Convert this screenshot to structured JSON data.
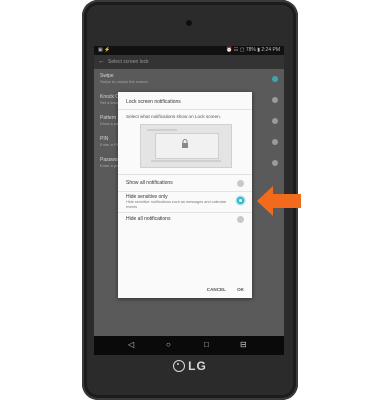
{
  "device": {
    "brand": "LG"
  },
  "status_bar": {
    "left_icons": "▣ ⚡",
    "right_text": "⏰ ☷ ▢ 78% ▮ 2:24 PM"
  },
  "title_bar": {
    "back_glyph": "←",
    "title": "Select screen lock"
  },
  "background_list": [
    {
      "label": "Swipe",
      "sub": "Swipe to unlock the screen",
      "selected": true
    },
    {
      "label": "Knock Code",
      "sub": "Set a knock code",
      "selected": false
    },
    {
      "label": "Pattern",
      "sub": "Draw a pattern",
      "selected": false
    },
    {
      "label": "PIN",
      "sub": "Enter a PIN",
      "selected": false
    },
    {
      "label": "Password",
      "sub": "Enter a password",
      "selected": false
    }
  ],
  "dialog": {
    "title": "Lock screen notifications",
    "subtitle": "Select what notifications show on Lock screen.",
    "options": [
      {
        "label": "Show all notifications",
        "sub": "",
        "selected": false
      },
      {
        "label": "Hide sensitive only",
        "sub": "Hide sensitive notifications such as messages and calendar events",
        "selected": true
      },
      {
        "label": "Hide all notifications",
        "sub": "",
        "selected": false
      }
    ],
    "cancel_label": "CANCEL",
    "ok_label": "OK"
  },
  "nav_bar": {
    "back_glyph": "◁",
    "home_glyph": "○",
    "recents_glyph": "□",
    "extra_glyph": "⊟"
  },
  "colors": {
    "accent": "#2fb7c2",
    "arrow": "#f26b1d"
  }
}
